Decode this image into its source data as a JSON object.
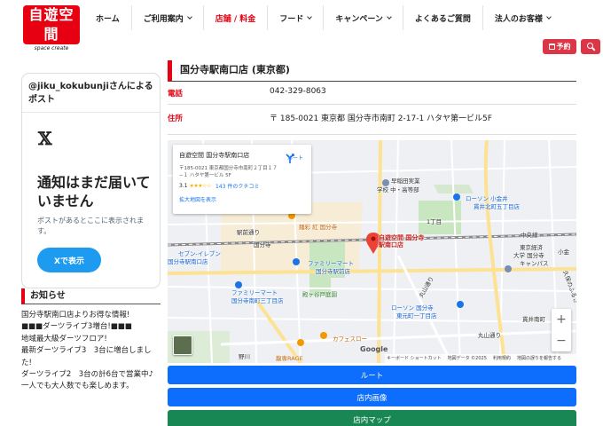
{
  "logo": {
    "main": "自遊空間",
    "sub": "space create"
  },
  "nav": [
    {
      "label": "ホーム",
      "has_dropdown": false,
      "active": false
    },
    {
      "label": "ご利用案内",
      "has_dropdown": true,
      "active": false
    },
    {
      "label": "店舗 / 料金",
      "has_dropdown": false,
      "active": true
    },
    {
      "label": "フード",
      "has_dropdown": true,
      "active": false
    },
    {
      "label": "キャンペーン",
      "has_dropdown": true,
      "active": false
    },
    {
      "label": "よくあるご質問",
      "has_dropdown": false,
      "active": false
    },
    {
      "label": "法人のお客様",
      "has_dropdown": true,
      "active": false
    }
  ],
  "header_buttons": {
    "reserve_label": "予約",
    "reserve_icon": "calendar-icon",
    "search_icon": "search-icon",
    "accent": "#dc3545"
  },
  "x_embed": {
    "title": "@jiku_kokubunjiさんによるポスト",
    "logo": "𝕏",
    "headline": "通知はまだ届いていません",
    "subtext": "ポストがあるとここに表示されます。",
    "button_label": "Xで表示"
  },
  "news": {
    "heading": "お知らせ",
    "lines": [
      "国分寺駅南口店よりお得な情報!",
      "",
      "■■■ダーツライブ3増台!■■■",
      "地域最大級ダーツフロア!",
      "最新ダーツライブ3　3台に増台しました!",
      "ダーツライブ2　3台の計6台で営業中♪",
      "一人でも大人数でも楽しめます。"
    ]
  },
  "store": {
    "title": "国分寺駅南口店 (東京都)",
    "phone_label": "電話",
    "phone": "042-329-8063",
    "address_label": "住所",
    "address": "〒 185-0021 東京都 国分寺市南町 2-17-1 ハタヤ第一ビル5F"
  },
  "map": {
    "card": {
      "name": "自遊空間 国分寺駅南口店",
      "address": "〒185-0021 東京都国分寺市南町２丁目１７−１ ハタヤ第一ビル 5F",
      "rating": "3.1",
      "stars": "★★★☆☆",
      "reviews": "143 件のクチコミ",
      "enlarge_link": "拡大地図を表示",
      "route_label": "ルート"
    },
    "pin_label": "自遊空間 国分寺\n駅南口店",
    "labels": {
      "waseda": "早稲田実業",
      "waseda2": "学校 中・高等部",
      "lawson1": "ローソン 小金井",
      "lawson1b": "貫井北町五丁目店",
      "chome1": "1丁目",
      "chuo": "中央線",
      "kokubunji": "国分寺",
      "ekimae": "駅前通り",
      "menya": "麺彩 紅 国分寺",
      "tgu": "東京経済",
      "tgu2": "大学 国分寺",
      "tgu3": "キャンパス",
      "koganei": "小金",
      "seven": "セブン-イレブン",
      "seven2": "国分寺駅南口店",
      "fm1": "ファミリーマート",
      "fm1b": "国分寺南町一丁目店",
      "fm2": "ファミリーマート",
      "fm2b": "国分寺駅前店",
      "tonogayato": "殿ヶ谷戸庭園",
      "fm3": "ファミリーマート",
      "fm3b": "国分寺南町三丁目店",
      "marusan": "丸山通り",
      "lawson2": "ローソン 国分寺",
      "lawson2b": "東元町一丁目店",
      "cafe": "カフェスロー",
      "nogawa": "野川",
      "ryusei": "龍専RAGE",
      "maruyama2": "丸山通り",
      "jurou": "久保のふるさ",
      "hagai": "貫井南町"
    },
    "google": "Google",
    "attribution": [
      "キーボード ショートカット",
      "地図データ ©2025",
      "利用規約",
      "地図の誤りを報告する"
    ],
    "zoom_in": "+",
    "zoom_out": "−"
  },
  "buttons": {
    "route": "ルート",
    "photos": "店内画像",
    "floor_map": "店内マップ"
  }
}
